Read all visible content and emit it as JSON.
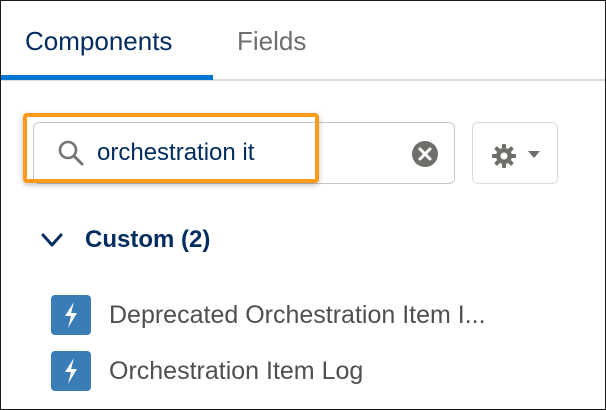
{
  "tabs": {
    "components_label": "Components",
    "fields_label": "Fields",
    "active": "Components"
  },
  "search": {
    "value": "orchestration it",
    "placeholder": ""
  },
  "icons": {
    "search": "search-icon",
    "clear": "clear-icon",
    "settings": "gear-icon",
    "dropdown": "caret-down-icon",
    "section_toggle": "chevron-down-icon",
    "component": "lightning-bolt-icon"
  },
  "section": {
    "title": "Custom (2)",
    "items": [
      {
        "label": "Deprecated Orchestration Item I..."
      },
      {
        "label": "Orchestration Item Log"
      }
    ]
  },
  "colors": {
    "active_tab_text": "#032d60",
    "active_tab_underline": "#0176d3",
    "inactive_tab_text": "#706e6b",
    "highlight_border": "#ff9a1a",
    "component_icon_bg": "#3a7cb5",
    "item_text": "#514f4d"
  }
}
